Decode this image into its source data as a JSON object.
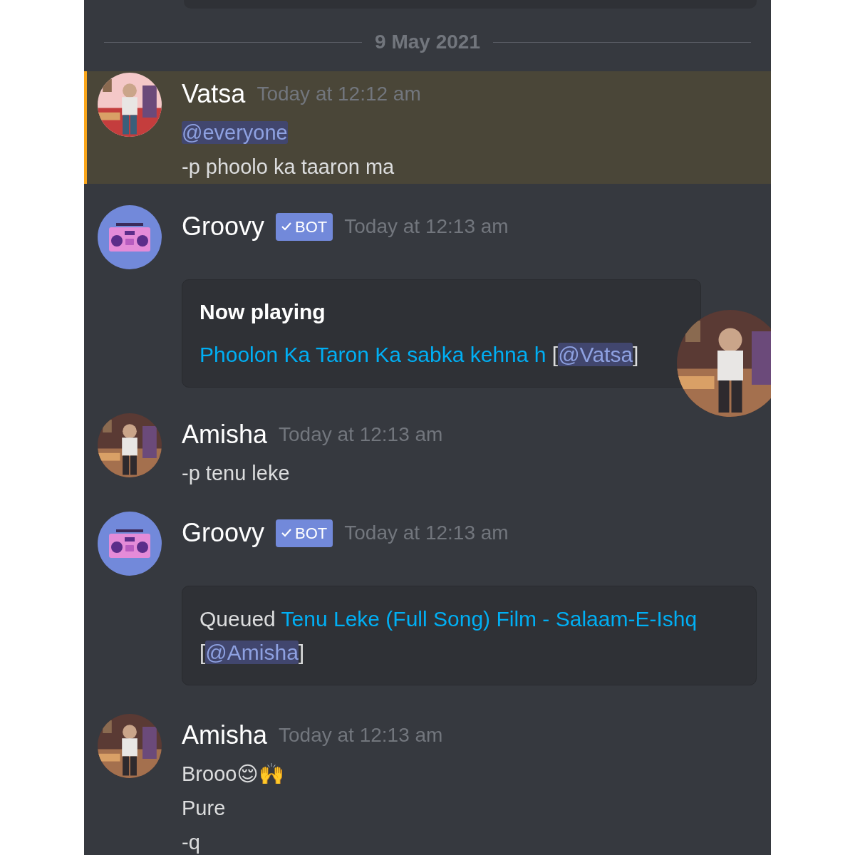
{
  "divider": {
    "date": "9 May 2021"
  },
  "messages": [
    {
      "author": "Vatsa",
      "avatar": {
        "kind": "picture"
      },
      "highlighted": true,
      "timestamp": "Today at 12:12 am",
      "content": [
        {
          "kind": "mention",
          "text": "@everyone"
        },
        {
          "kind": "text",
          "text": "-p phoolo ka taaron ma"
        }
      ]
    },
    {
      "author": "Groovy",
      "avatar": {
        "kind": "boombox"
      },
      "bot_tag": "BOT",
      "highlighted": false,
      "timestamp": "Today at 12:13 am",
      "embed": {
        "title": "Now playing",
        "description": [
          {
            "kind": "link",
            "text": "Phoolon Ka Taron Ka sabka kehna h"
          },
          {
            "kind": "text",
            "text": " ["
          },
          {
            "kind": "mention",
            "text": "@Vatsa"
          },
          {
            "kind": "text",
            "text": "]"
          }
        ]
      }
    },
    {
      "author": "Amisha",
      "avatar": {
        "kind": "picture"
      },
      "highlighted": false,
      "timestamp": "Today at 12:13 am",
      "content": [
        {
          "kind": "text",
          "text": "-p tenu leke"
        }
      ]
    },
    {
      "author": "Groovy",
      "avatar": {
        "kind": "boombox"
      },
      "bot_tag": "BOT",
      "highlighted": false,
      "timestamp": "Today at 12:13 am",
      "embed": {
        "description": [
          {
            "kind": "text",
            "text": "Queued "
          },
          {
            "kind": "link",
            "text": "Tenu Leke (Full Song) Film - Salaam-E-Ishq"
          },
          {
            "kind": "text",
            "text": " ["
          },
          {
            "kind": "mention",
            "text": "@Amisha"
          },
          {
            "kind": "text",
            "text": "]"
          }
        ]
      }
    },
    {
      "author": "Amisha",
      "avatar": {
        "kind": "picture"
      },
      "highlighted": false,
      "timestamp": "Today at 12:13 am",
      "content": [
        {
          "kind": "text",
          "text": "Brooo😌🙌"
        },
        {
          "kind": "text",
          "text": "Pure"
        },
        {
          "kind": "text",
          "text": "-q"
        }
      ]
    }
  ],
  "floating_avatar": {
    "kind": "picture"
  }
}
